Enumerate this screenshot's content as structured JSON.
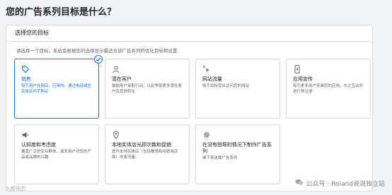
{
  "page": {
    "title": "您的广告系列目标是什么？"
  },
  "panel": {
    "header": "选择您的目标",
    "description": "请选择一个目标。系统会根据您的选择显示最适合该广告系列的优化目标和设置"
  },
  "goals": [
    {
      "title": "销售",
      "description": "吸引用户在网店、应用内、通过电话或在实体店内手购买",
      "icon": "tag-icon",
      "selected": true
    },
    {
      "title": "潜在客户",
      "description": "鼓励用户采取行动，以此争取更多潜在客户及其他转化",
      "icon": "person-icon",
      "selected": false
    },
    {
      "title": "网站流量",
      "description": "吸引目标受众访问您的网站",
      "icon": "cursor-click-icon",
      "selected": false
    },
    {
      "title": "应用宣传",
      "description": "吸引更多用户安装您的应用，与之互动并进行预注册",
      "icon": "phone-icon",
      "selected": false
    },
    {
      "title": "认知度和考虑度",
      "description": "覆盖广泛的受众群体，激发用户对您的产品或品牌的兴趣",
      "icon": "megaphone-icon",
      "selected": false
    },
    {
      "title": "本地实体店光顾次数和促销",
      "description": "提升本地实体店（包括餐馆和经销商店面）的客流量。",
      "icon": "location-pin-icon",
      "selected": false
    },
    {
      "title": "在没有指导的情况下制作广告系列",
      "description": "继下来选择广告系列",
      "icon": "gear-icon",
      "selected": false
    }
  ],
  "watermark": {
    "text": "公众号 · Roland说说独立站",
    "left_text": "九都视图"
  },
  "colors": {
    "accent": "#1a73e8",
    "border": "#dadce0"
  }
}
